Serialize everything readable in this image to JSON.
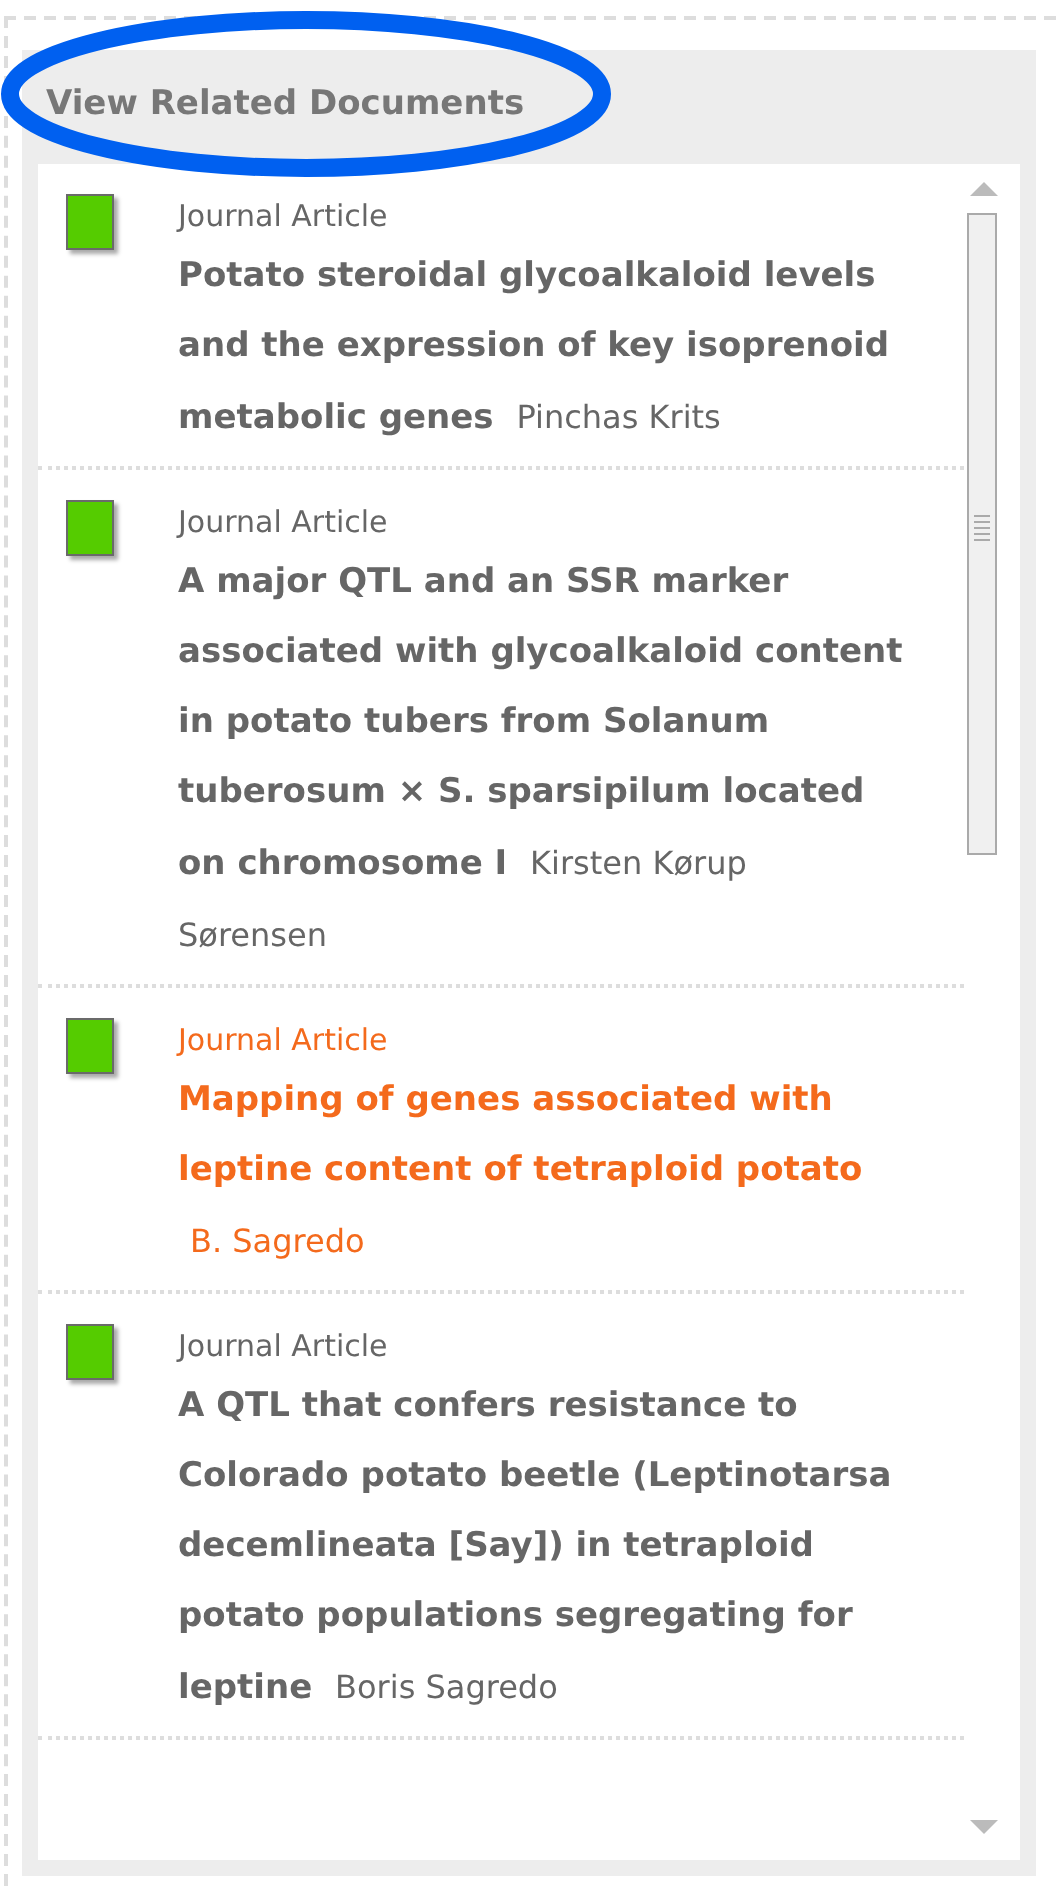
{
  "panel": {
    "title": "View Related Documents"
  },
  "documents": [
    {
      "type": "Journal Article",
      "title": "Potato steroidal glycoalkaloid levels and the expression of key isoprenoid metabolic genes",
      "author": "Pinchas Krits",
      "highlighted": false
    },
    {
      "type": "Journal Article",
      "title": "A major QTL and an SSR marker associated with glycoalkaloid content in potato tubers from Solanum tuberosum × S. sparsipilum located on chromosome I",
      "author": "Kirsten Kørup Sørensen",
      "highlighted": false
    },
    {
      "type": "Journal Article",
      "title": "Mapping of genes associated with leptine content of tetraploid potato",
      "author": "B. Sagredo",
      "highlighted": true
    },
    {
      "type": "Journal Article",
      "title": "A QTL that confers resistance to Colorado potato beetle (Leptinotarsa decemlineata [Say]) in tetraploid potato populations segregating for leptine",
      "author": "Boris Sagredo",
      "highlighted": false
    }
  ]
}
